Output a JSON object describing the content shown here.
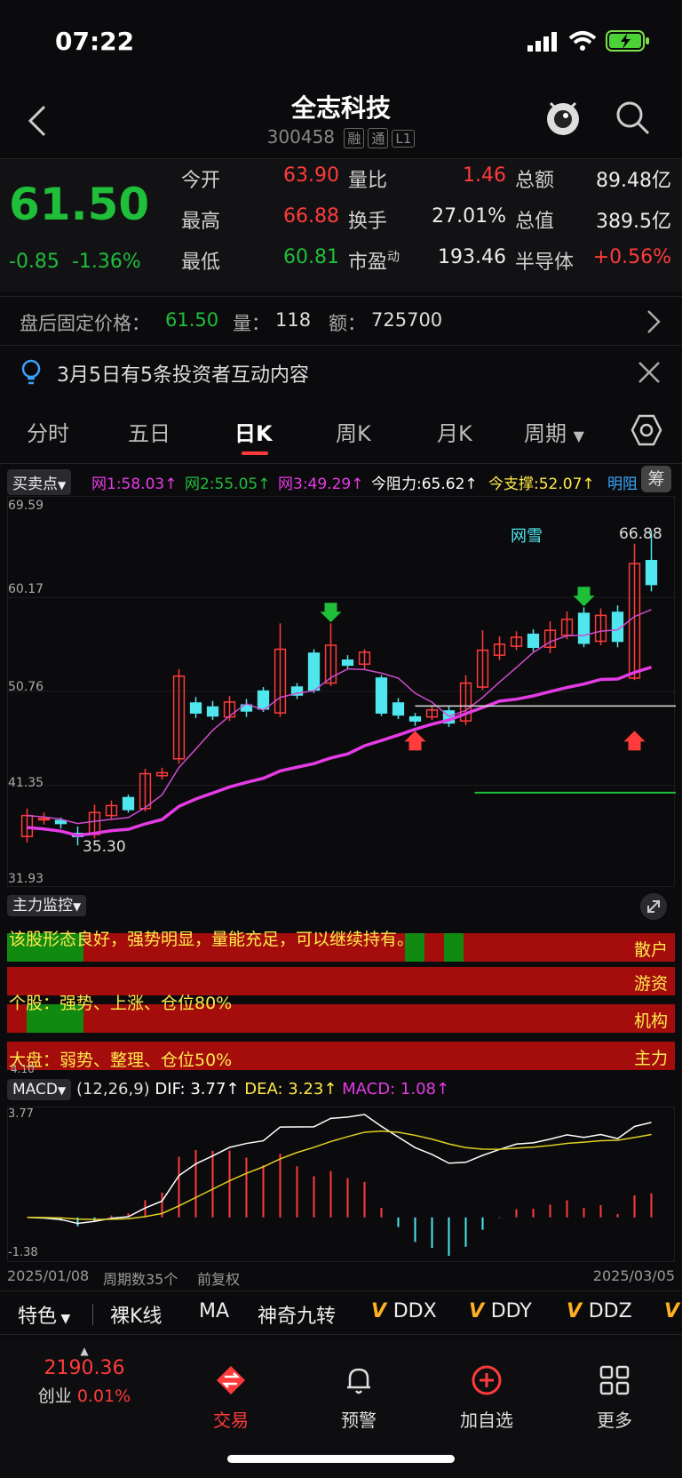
{
  "status_bar": {
    "time": "07:22"
  },
  "header": {
    "title": "全志科技",
    "code": "300458",
    "tags": [
      "融",
      "通",
      "L1"
    ]
  },
  "quote": {
    "price": "61.50",
    "change": "-0.85",
    "change_pct": "-1.36%",
    "rows": [
      {
        "l1": "今开",
        "v1": "63.90",
        "l2": "量比",
        "v2": "1.46",
        "l3": "总额",
        "v3": "89.48亿"
      },
      {
        "l1": "最高",
        "v1": "66.88",
        "l2": "换手",
        "v2": "27.01%",
        "l3": "总值",
        "v3": "389.5亿"
      },
      {
        "l1": "最低",
        "v1": "60.81",
        "l2": "市盈",
        "l2_sup": "动",
        "v2": "193.46",
        "l3": "半导体",
        "v3": "+0.56%"
      }
    ]
  },
  "after_hours": {
    "label": "盘后固定价格：",
    "price": "61.50",
    "vol_label": "量：",
    "vol": "118",
    "amt_label": "额：",
    "amt": "725700"
  },
  "notice": {
    "text": "3月5日有5条投资者互动内容"
  },
  "tabs": [
    {
      "label": "分时"
    },
    {
      "label": "五日"
    },
    {
      "label": "日K",
      "active": true
    },
    {
      "label": "周K"
    },
    {
      "label": "月K"
    },
    {
      "label": "周期"
    }
  ],
  "indicators": {
    "selector": "买卖点",
    "items": [
      {
        "text": "网1:58.03↑",
        "color": "#e53be5"
      },
      {
        "text": "网2:55.05↑",
        "color": "#1fbf3a"
      },
      {
        "text": "网3:49.29↑",
        "color": "#e53be5"
      },
      {
        "text": "今阻力:65.62↑",
        "color": "#ffffff"
      },
      {
        "text": "今支撑:52.07↑",
        "color": "#ffe94a"
      },
      {
        "text": "明阻",
        "color": "#3aaaff"
      }
    ],
    "chip_btn": "筹"
  },
  "chart_data": {
    "type": "candlestick",
    "y_ticks": [
      "69.59",
      "60.17",
      "50.76",
      "41.35",
      "31.93"
    ],
    "ylim": [
      31.93,
      69.59
    ],
    "high_label": "66.88",
    "low_label": "35.30",
    "annotation": "网雪",
    "candles": [
      {
        "o": 36.2,
        "c": 38.3,
        "h": 39.0,
        "l": 35.6
      },
      {
        "o": 37.9,
        "c": 38.0,
        "h": 38.6,
        "l": 37.4
      },
      {
        "o": 37.8,
        "c": 37.5,
        "h": 38.1,
        "l": 37.0
      },
      {
        "o": 36.5,
        "c": 36.2,
        "h": 37.2,
        "l": 35.3
      },
      {
        "o": 36.4,
        "c": 38.6,
        "h": 39.4,
        "l": 36.0
      },
      {
        "o": 38.3,
        "c": 39.3,
        "h": 39.8,
        "l": 37.9
      },
      {
        "o": 40.1,
        "c": 38.9,
        "h": 40.4,
        "l": 38.6
      },
      {
        "o": 39.0,
        "c": 42.5,
        "h": 43.0,
        "l": 38.7
      },
      {
        "o": 42.3,
        "c": 42.6,
        "h": 43.1,
        "l": 41.9
      },
      {
        "o": 44.0,
        "c": 52.3,
        "h": 53.0,
        "l": 43.5
      },
      {
        "o": 49.6,
        "c": 48.6,
        "h": 50.2,
        "l": 48.1
      },
      {
        "o": 49.2,
        "c": 48.3,
        "h": 49.8,
        "l": 47.9
      },
      {
        "o": 48.2,
        "c": 49.7,
        "h": 50.3,
        "l": 47.8
      },
      {
        "o": 49.4,
        "c": 48.8,
        "h": 50.0,
        "l": 48.2
      },
      {
        "o": 50.8,
        "c": 49.0,
        "h": 51.2,
        "l": 48.7
      },
      {
        "o": 48.6,
        "c": 55.0,
        "h": 57.6,
        "l": 48.2
      },
      {
        "o": 51.2,
        "c": 50.4,
        "h": 51.6,
        "l": 50.0
      },
      {
        "o": 54.6,
        "c": 50.9,
        "h": 55.0,
        "l": 50.6
      },
      {
        "o": 51.6,
        "c": 55.4,
        "h": 57.6,
        "l": 51.3
      },
      {
        "o": 53.9,
        "c": 53.4,
        "h": 54.4,
        "l": 53.0
      },
      {
        "o": 53.5,
        "c": 54.7,
        "h": 55.0,
        "l": 53.0
      },
      {
        "o": 52.1,
        "c": 48.6,
        "h": 52.4,
        "l": 48.3
      },
      {
        "o": 49.6,
        "c": 48.4,
        "h": 50.1,
        "l": 48.0
      },
      {
        "o": 48.2,
        "c": 47.8,
        "h": 48.6,
        "l": 47.3
      },
      {
        "o": 48.2,
        "c": 48.9,
        "h": 49.4,
        "l": 47.9
      },
      {
        "o": 48.8,
        "c": 47.6,
        "h": 49.3,
        "l": 47.2
      },
      {
        "o": 47.8,
        "c": 51.6,
        "h": 52.4,
        "l": 47.4
      },
      {
        "o": 51.2,
        "c": 54.9,
        "h": 56.9,
        "l": 50.9
      },
      {
        "o": 54.4,
        "c": 55.5,
        "h": 56.3,
        "l": 53.9
      },
      {
        "o": 55.3,
        "c": 56.2,
        "h": 56.8,
        "l": 54.9
      },
      {
        "o": 56.5,
        "c": 55.2,
        "h": 57.0,
        "l": 54.8
      },
      {
        "o": 55.2,
        "c": 56.9,
        "h": 57.8,
        "l": 54.6
      },
      {
        "o": 56.4,
        "c": 58.0,
        "h": 58.8,
        "l": 56.0
      },
      {
        "o": 58.6,
        "c": 55.6,
        "h": 59.2,
        "l": 55.2
      },
      {
        "o": 55.8,
        "c": 58.4,
        "h": 59.1,
        "l": 55.4
      },
      {
        "o": 58.7,
        "c": 55.8,
        "h": 59.4,
        "l": 55.2
      },
      {
        "o": 52.1,
        "c": 63.6,
        "h": 65.6,
        "l": 51.9
      },
      {
        "o": 63.9,
        "c": 61.5,
        "h": 66.88,
        "l": 60.81
      }
    ]
  },
  "main_monitor": {
    "selector": "主力监控",
    "comment": "该股形态良好，强势明显，量能充足，可以继续持有。",
    "stock_text": "个股：强势、上涨、仓位80%",
    "market_text": "大盘：弱势、整理、仓位50%",
    "market_left_value": "4.10",
    "rows": [
      "散户",
      "游资",
      "机构",
      "主力"
    ]
  },
  "macd": {
    "selector": "MACD",
    "params": "(12,26,9)",
    "dif": "DIF: 3.77↑",
    "dea": "DEA: 3.23↑",
    "macd_val": "MACD: 1.08↑",
    "y_top": "3.77",
    "y_bottom": "-1.38"
  },
  "footer_axis": {
    "start": "2025/01/08",
    "periods": "周期数35个",
    "adj": "前复权",
    "end": "2025/03/05"
  },
  "toolbar": {
    "items": [
      "特色",
      "裸K线",
      "MA",
      "神奇九转",
      "DDX",
      "DDY",
      "DDZ"
    ]
  },
  "bottom_nav": {
    "index_value": "2190.36",
    "index_name": "创业",
    "index_chg": "0.01%",
    "items": [
      "交易",
      "预警",
      "加自选",
      "更多"
    ]
  },
  "colors": {
    "up": "#ff3b3b",
    "down": "#1fbf3a",
    "cyan": "#4fe6ee",
    "magenta": "#e53be5",
    "yellow": "#ffe94a"
  }
}
